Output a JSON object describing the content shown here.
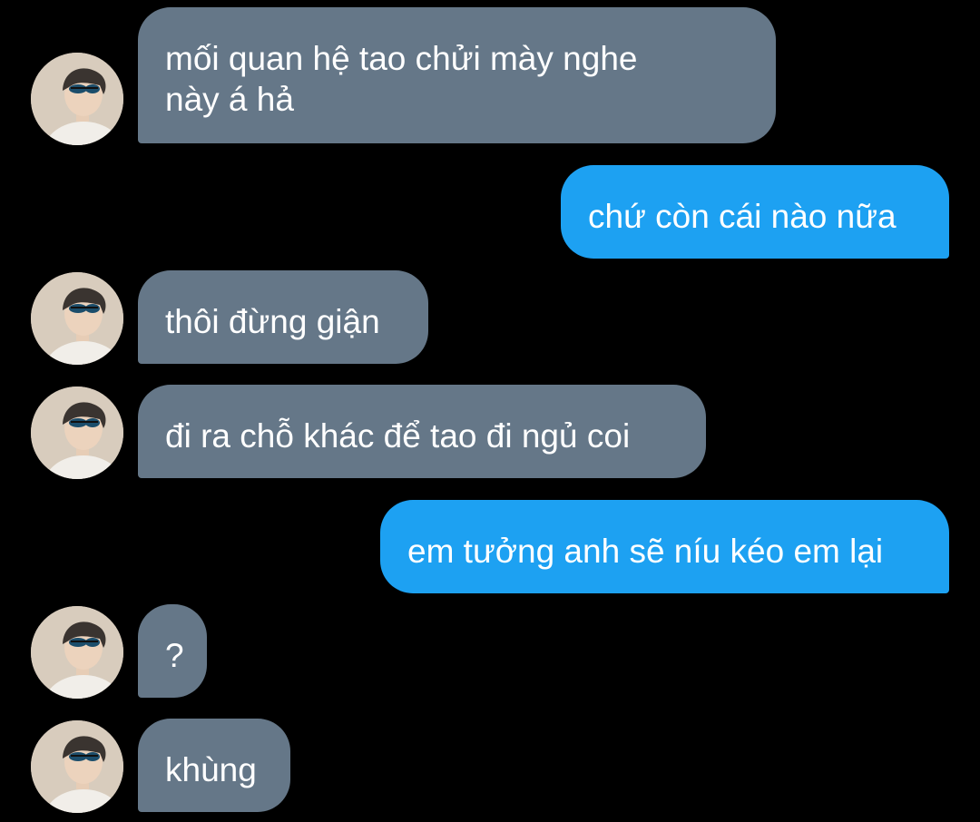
{
  "messages": [
    {
      "side": "received",
      "lines": [
        "mối quan hệ tao chửi mày nghe",
        "này á hả"
      ]
    },
    {
      "side": "sent",
      "lines": [
        "chứ còn cái nào nữa"
      ]
    },
    {
      "side": "received",
      "lines": [
        "thôi đừng giận"
      ]
    },
    {
      "side": "received",
      "lines": [
        "đi ra chỗ khác để tao đi ngủ coi"
      ]
    },
    {
      "side": "sent",
      "lines": [
        "em tưởng anh sẽ níu kéo em lại"
      ]
    },
    {
      "side": "received",
      "lines": [
        "?"
      ]
    },
    {
      "side": "received",
      "lines": [
        "khùng"
      ]
    }
  ],
  "colors": {
    "background": "#000000",
    "received_bubble": "#657788",
    "sent_bubble": "#1da1f2",
    "text": "#ffffff"
  },
  "avatar_icon": "person-with-sunglasses-avatar"
}
